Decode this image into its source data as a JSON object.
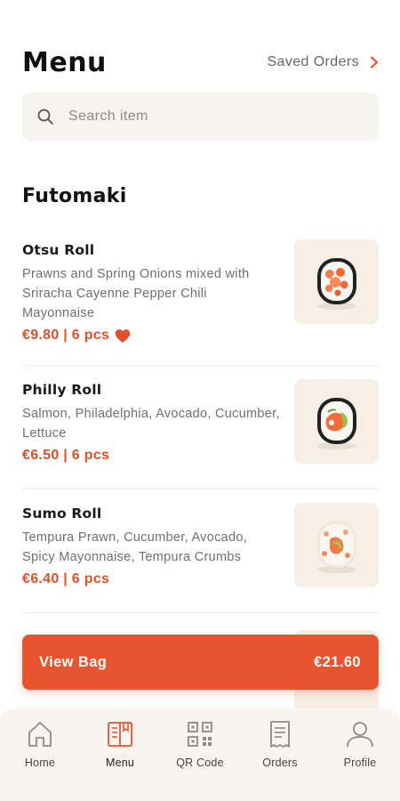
{
  "header": {
    "title": "Menu",
    "saved_orders_label": "Saved Orders",
    "chevron_icon": "chevron-right-icon"
  },
  "search": {
    "placeholder": "Search item",
    "icon": "search-icon"
  },
  "section": {
    "title": "Futomaki"
  },
  "items": [
    {
      "name": "Otsu Roll",
      "description": "Prawns and Spring Onions mixed with Sriracha Cayenne Pepper Chili Mayonnaise",
      "price": "€9.80 | 6 pcs",
      "favorite": true,
      "favorite_icon": "heart-icon"
    },
    {
      "name": "Philly Roll",
      "description": "Salmon, Philadelphia, Avocado, Cucumber, Lettuce",
      "price": "€6.50 | 6 pcs",
      "favorite": false
    },
    {
      "name": "Sumo Roll",
      "description": "Tempura Prawn, Cucumber, Avocado, Spicy Mayonnaise, Tempura Crumbs",
      "price": "€6.40 | 6 pcs",
      "favorite": false
    }
  ],
  "bag": {
    "label": "View Bag",
    "total": "€21.60"
  },
  "tabbar": {
    "tabs": [
      {
        "label": "Home",
        "icon": "home-icon",
        "active": false
      },
      {
        "label": "Menu",
        "icon": "menu-book-icon",
        "active": true
      },
      {
        "label": "QR Code",
        "icon": "qr-code-icon",
        "active": false
      },
      {
        "label": "Orders",
        "icon": "receipt-icon",
        "active": false
      },
      {
        "label": "Profile",
        "icon": "person-icon",
        "active": false
      }
    ]
  },
  "colors": {
    "accent": "#e8542f",
    "price": "#e0512b",
    "thumb_bg": "#f7efe6",
    "search_bg": "#f7f3ee"
  }
}
